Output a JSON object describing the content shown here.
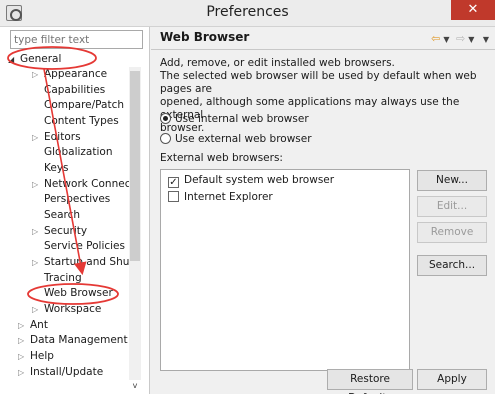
{
  "window": {
    "title": "Preferences",
    "close_label": "✕"
  },
  "sidebar": {
    "filter_placeholder": "type filter text",
    "items": [
      {
        "label": "General",
        "arrow": "◢",
        "expanded": true
      },
      {
        "label": "Appearance",
        "arrow": "▷"
      },
      {
        "label": "Capabilities"
      },
      {
        "label": "Compare/Patch"
      },
      {
        "label": "Content Types"
      },
      {
        "label": "Editors",
        "arrow": "▷"
      },
      {
        "label": "Globalization"
      },
      {
        "label": "Keys"
      },
      {
        "label": "Network Connecti",
        "arrow": "▷"
      },
      {
        "label": "Perspectives"
      },
      {
        "label": "Search"
      },
      {
        "label": "Security",
        "arrow": "▷"
      },
      {
        "label": "Service Policies"
      },
      {
        "label": "Startup and Shutd",
        "arrow": "▷"
      },
      {
        "label": "Tracing"
      },
      {
        "label": "Web Browser"
      },
      {
        "label": "Workspace",
        "arrow": "▷"
      },
      {
        "label": "Ant",
        "arrow": "▷"
      },
      {
        "label": "Data Management",
        "arrow": "▷"
      },
      {
        "label": "Help",
        "arrow": "▷"
      },
      {
        "label": "Install/Update",
        "arrow": "▷"
      }
    ],
    "scroll_up": "^",
    "scroll_down": "v"
  },
  "page": {
    "title": "Web Browser",
    "nav_icons": [
      "back-arrow-icon",
      "dropdown-icon",
      "forward-arrow-icon",
      "dropdown-icon",
      "menu-dropdown-icon"
    ],
    "description_lines": [
      "Add, remove, or edit installed web browsers.",
      "The selected web browser will be used by default when web pages are",
      "opened, although some applications may always use the external",
      "browser."
    ],
    "radio_internal": "Use internal web browser",
    "radio_external": "Use external web browser",
    "radio_selected": "internal",
    "external_label": "External web browsers:",
    "browsers": [
      {
        "label": "Default system web browser",
        "checked": true
      },
      {
        "label": "Internet Explorer",
        "checked": false
      }
    ],
    "buttons": {
      "new": "New...",
      "edit": "Edit...",
      "remove": "Remove",
      "search": "Search..."
    },
    "restore_defaults": "Restore Defaults",
    "apply": "Apply"
  },
  "colors": {
    "annotation_red": "#e53935",
    "accent": "#e09a2a",
    "close_bg": "#c0392b"
  }
}
